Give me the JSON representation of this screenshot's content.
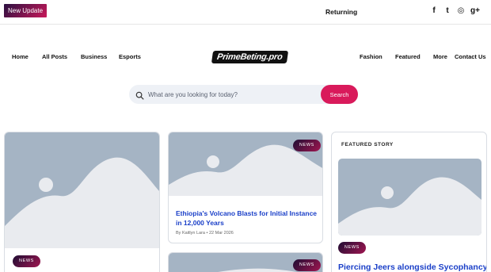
{
  "topbar": {
    "update_label": "New Update",
    "ticker_text": "Returning to",
    "social": [
      {
        "icon": "facebook-icon",
        "glyph": "f"
      },
      {
        "icon": "twitter-icon",
        "glyph": "t"
      },
      {
        "icon": "instagram-icon",
        "glyph": "◎"
      },
      {
        "icon": "google-plus-icon",
        "glyph": "g+"
      }
    ]
  },
  "nav": {
    "left": [
      "Home",
      "All Posts",
      "Business",
      "Esports"
    ],
    "logo": "PrimeBeting.pro",
    "right": [
      "Fashion",
      "Featured",
      "More",
      "Contact Us"
    ]
  },
  "search": {
    "placeholder": "What are you looking for today?",
    "button_label": "Search"
  },
  "cards": {
    "first": {
      "tag": "NEWS"
    },
    "second": {
      "tag": "NEWS",
      "title": "Ethiopia's Volcano Blasts for Initial Instance in 12,000 Years",
      "author": "By Kaitlyn Lara",
      "date": "• 22 Mar 2026"
    },
    "third": {
      "tag": "NEWS"
    },
    "featured": {
      "heading": "FEATURED STORY",
      "tag": "NEWS",
      "title": "Piercing Jeers alongside Sycophancy,"
    }
  },
  "colors": {
    "accent": "#d91a5b",
    "link": "#1a3fc8",
    "placeholder_bg": "#a5b4c4",
    "placeholder_fg": "#e9ebef"
  }
}
